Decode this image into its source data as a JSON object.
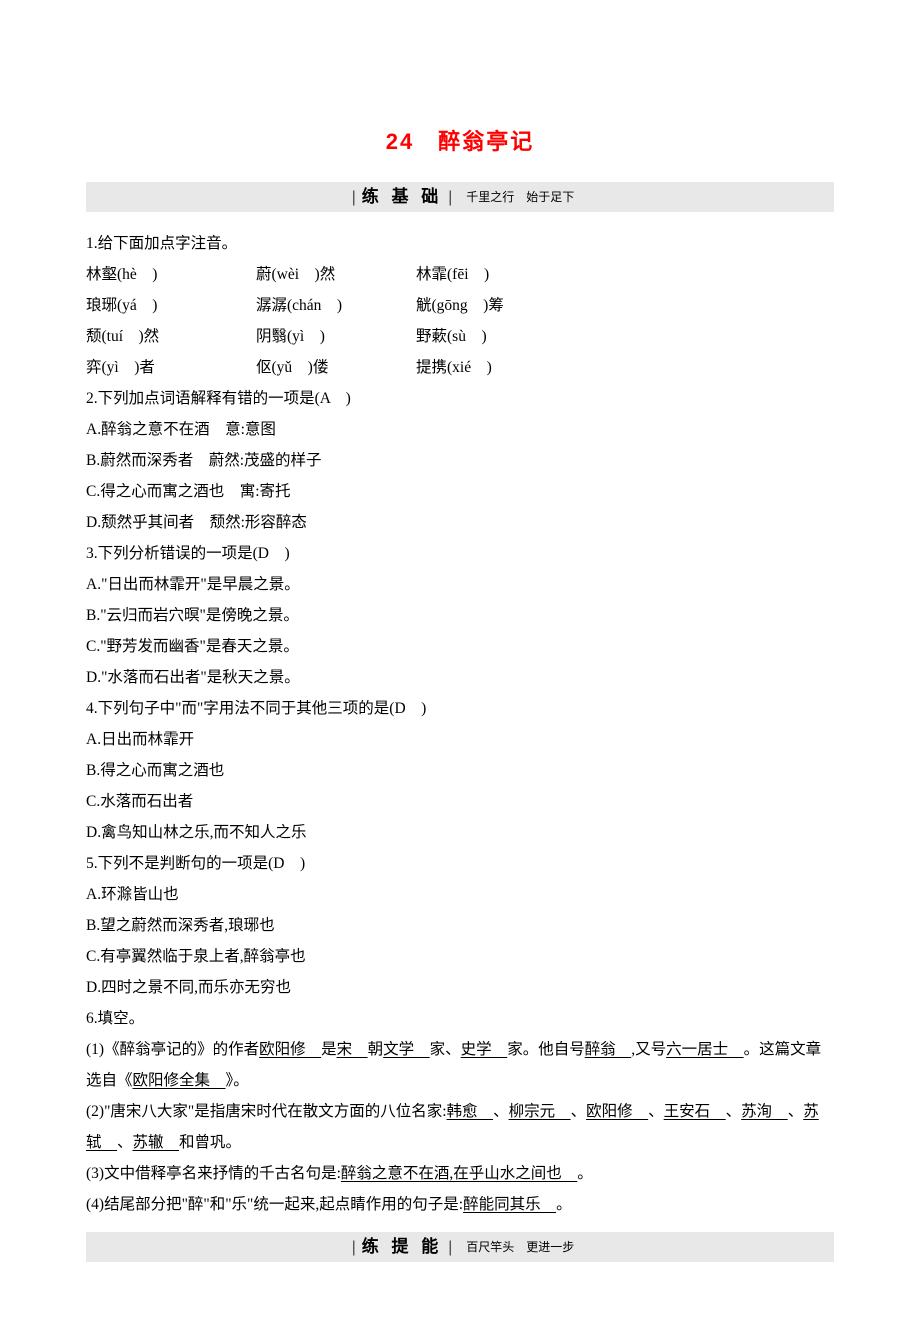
{
  "title": "24　醉翁亭记",
  "section_basic": {
    "left": "练 基 础",
    "right": "千里之行　始于足下"
  },
  "section_advance": {
    "left": "练 提 能",
    "right": "百尺竿头　更进一步"
  },
  "q1": {
    "prompt": "1.给下面加点字注音。",
    "rows": [
      [
        "林壑(hè　)",
        "蔚(wèi　)然",
        "林霏(fēi　)"
      ],
      [
        "琅琊(yá　)",
        "潺潺(chán　)",
        "觥(gōng　)筹"
      ],
      [
        "颓(tuí　)然",
        "阴翳(yì　)",
        "野蔌(sù　)"
      ],
      [
        "弈(yì　)者",
        "伛(yǔ　)偻",
        "提携(xié　)"
      ]
    ]
  },
  "q2": {
    "prompt": "2.下列加点词语解释有错的一项是(A　)",
    "options": [
      "A.醉翁之意不在酒　意:意图",
      "B.蔚然而深秀者　蔚然:茂盛的样子",
      "C.得之心而寓之酒也　寓:寄托",
      "D.颓然乎其间者　颓然:形容醉态"
    ]
  },
  "q3": {
    "prompt": "3.下列分析错误的一项是(D　)",
    "options": [
      "A.\"日出而林霏开\"是早晨之景。",
      "B.\"云归而岩穴暝\"是傍晚之景。",
      "C.\"野芳发而幽香\"是春天之景。",
      "D.\"水落而石出者\"是秋天之景。"
    ]
  },
  "q4": {
    "prompt": "4.下列句子中\"而\"字用法不同于其他三项的是(D　)",
    "options": [
      "A.日出而林霏开",
      "B.得之心而寓之酒也",
      "C.水落而石出者",
      "D.禽鸟知山林之乐,而不知人之乐"
    ]
  },
  "q5": {
    "prompt": "5.下列不是判断句的一项是(D　)",
    "options": [
      "A.环滁皆山也",
      "B.望之蔚然而深秀者,琅琊也",
      "C.有亭翼然临于泉上者,醉翁亭也",
      "D.四时之景不同,而乐亦无穷也"
    ]
  },
  "q6": {
    "prompt": "6.填空。",
    "sub1": {
      "a": "(1)《醉翁亭记的》的作者",
      "u1": "欧阳修　",
      "b": "是",
      "u2": "宋　",
      "c": "朝",
      "u3": "文学　",
      "d": "家、",
      "u4": "史学　",
      "e": "家。他自号",
      "u5": "醉翁　",
      "f": ",又号",
      "u6": "六一居士　",
      "g": "。这篇文章选自《",
      "u7": "欧阳修全集　",
      "h": "》。"
    },
    "sub2": {
      "a": "(2)\"唐宋八大家\"是指唐宋时代在散文方面的八位名家:",
      "u1": "韩愈　",
      "b": "、",
      "u2": "柳宗元　",
      "c": "、",
      "u3": "欧阳修　",
      "d": "、",
      "u4": "王安石　",
      "e": "、",
      "u5": "苏洵　",
      "f": "、",
      "u6": "苏轼　",
      "g": "、",
      "u7": "苏辙　",
      "h": "和曾巩。"
    },
    "sub3": {
      "a": "(3)文中借释亭名来抒情的千古名句是:",
      "u1": "醉翁之意不在酒,在乎山水之间也　",
      "b": "。"
    },
    "sub4": {
      "a": "(4)结尾部分把\"醉\"和\"乐\"统一起来,起点睛作用的句子是:",
      "u1": "醉能同其乐　",
      "b": "。"
    }
  }
}
